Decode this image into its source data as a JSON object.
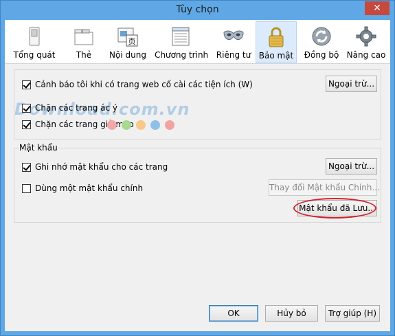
{
  "window": {
    "title": "Tùy chọn",
    "close_label": "✕"
  },
  "tabs": [
    {
      "label": "Tổng quát",
      "icon": "switch-icon"
    },
    {
      "label": "Thẻ",
      "icon": "tabs-icon"
    },
    {
      "label": "Nội dung",
      "icon": "content-icon"
    },
    {
      "label": "Chương trình",
      "icon": "applications-icon"
    },
    {
      "label": "Riêng tư",
      "icon": "mask-icon"
    },
    {
      "label": "Bảo mật",
      "icon": "padlock-icon",
      "selected": true
    },
    {
      "label": "Đồng bộ",
      "icon": "sync-icon"
    },
    {
      "label": "Nâng cao",
      "icon": "gear-icon"
    }
  ],
  "security": {
    "warn_addons_label": "Cảnh báo tôi khi có trang web cố cài các tiện ích (W)",
    "warn_addons_checked": true,
    "exceptions_label": "Ngoại trừ...",
    "block_attack_label": "Chặn các trang ác ý",
    "block_attack_checked": true,
    "block_forgery_label": "Chặn các trang giả mạo",
    "block_forgery_checked": true
  },
  "passwords": {
    "legend": "Mật khẩu",
    "remember_label": "Ghi nhớ mật khẩu cho các trang",
    "remember_checked": true,
    "exceptions_label": "Ngoại trừ...",
    "master_label": "Dùng một mật khẩu chính",
    "master_checked": false,
    "change_master_label": "Thay đổi Mật khẩu Chính...",
    "saved_passwords_label": "Mật khẩu đã Lưu..."
  },
  "footer": {
    "ok_label": "OK",
    "cancel_label": "Hủy bỏ",
    "help_label": "Trợ giúp (H)"
  },
  "watermark": {
    "text": "Download.com.vn",
    "dot_colors": [
      "#f3a7a7",
      "#a7d98f",
      "#f7c98a",
      "#8ec1ea",
      "#f1a3a3"
    ]
  }
}
